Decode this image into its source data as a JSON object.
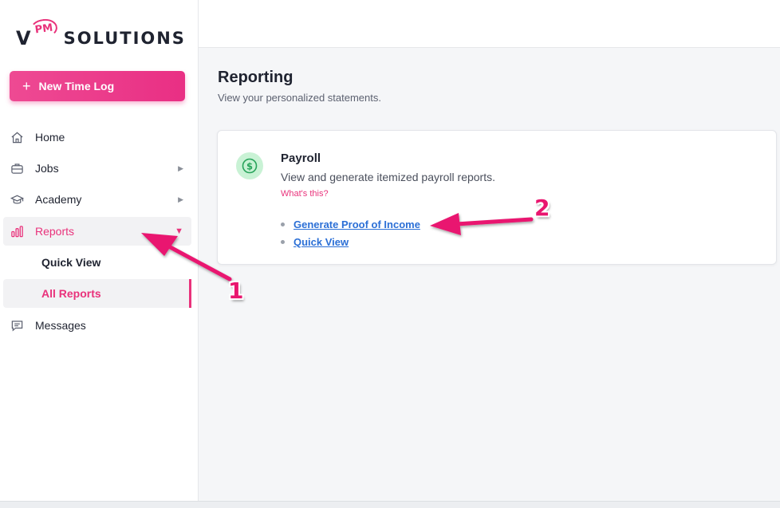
{
  "app": {
    "logo_mark": "V",
    "logo_pm": "PM",
    "logo_text": "SOLUTIONS",
    "brand_color": "#e9327b"
  },
  "sidebar": {
    "new_time_log": {
      "icon": "plus-icon",
      "label": "New Time Log"
    },
    "items": [
      {
        "label": "Home",
        "icon": "home-icon"
      },
      {
        "label": "Jobs",
        "icon": "briefcase-icon",
        "expandable": true
      },
      {
        "label": "Academy",
        "icon": "graduation-cap-icon",
        "expandable": true
      },
      {
        "label": "Reports",
        "icon": "bar-chart-icon",
        "expanded": true,
        "active": true
      },
      {
        "label": "Messages",
        "icon": "message-icon"
      }
    ],
    "reports_subitems": [
      {
        "label": "Quick View",
        "selected": false
      },
      {
        "label": "All Reports",
        "selected": true
      }
    ]
  },
  "main": {
    "title": "Reporting",
    "subtitle": "View your personalized statements.",
    "card": {
      "icon": "dollar-icon",
      "title": "Payroll",
      "description": "View and generate itemized payroll reports.",
      "help_link": "What's this?",
      "links": [
        {
          "label": "Generate Proof of Income"
        },
        {
          "label": "Quick View"
        }
      ]
    }
  },
  "annotations": [
    {
      "number": "1",
      "points_to": "Reports",
      "color": "#e9166f"
    },
    {
      "number": "2",
      "points_to": "Generate Proof of Income",
      "color": "#e9166f"
    }
  ]
}
